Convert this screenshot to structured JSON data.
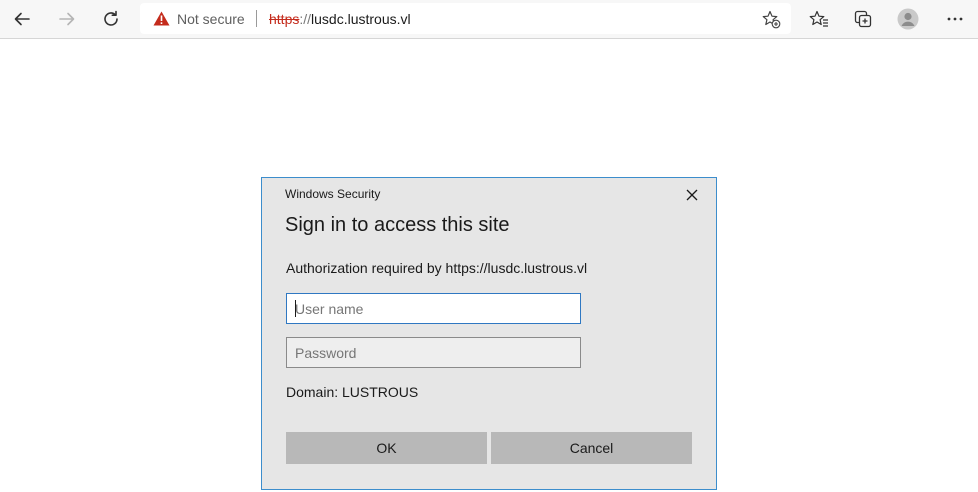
{
  "browser": {
    "address_bar": {
      "security_label": "Not secure",
      "url_scheme": "https",
      "url_separator": "://",
      "url_host": "lusdc.lustrous.vl"
    },
    "icons": [
      "back-arrow-icon",
      "forward-arrow-icon",
      "refresh-icon",
      "warning-icon",
      "add-favorite-icon",
      "favorites-icon",
      "collections-icon",
      "profile-icon",
      "more-icon"
    ]
  },
  "dialog": {
    "window_title": "Windows Security",
    "heading": "Sign in to access this site",
    "authorization_text": "Authorization required by https://lusdc.lustrous.vl",
    "username": {
      "value": "",
      "placeholder": "User name"
    },
    "password": {
      "value": "",
      "placeholder": "Password"
    },
    "domain_text": "Domain: LUSTROUS",
    "ok_label": "OK",
    "cancel_label": "Cancel"
  },
  "colors": {
    "dialog_border": "#3c8dcc",
    "warning_red": "#c42b1c",
    "dialog_bg": "#e6e6e6",
    "button_bg": "#b8b8b8"
  }
}
